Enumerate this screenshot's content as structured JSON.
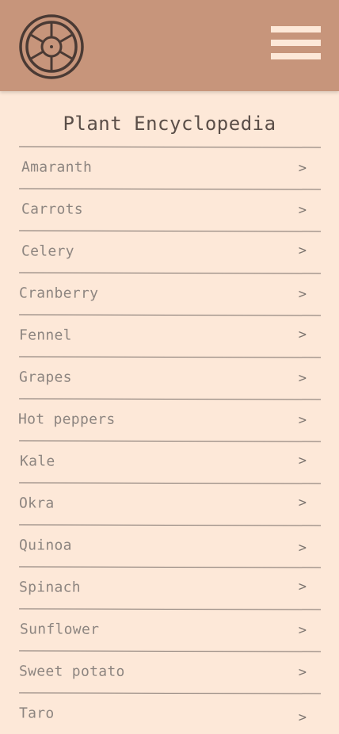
{
  "header": {
    "logo_icon": "ship-wheel-icon",
    "menu_icon": "hamburger-menu-icon"
  },
  "title": "Plant Encyclopedia",
  "plants": [
    {
      "label": "Amaranth",
      "chevron": ">"
    },
    {
      "label": "Carrots",
      "chevron": ">"
    },
    {
      "label": "Celery",
      "chevron": ">"
    },
    {
      "label": "Cranberry",
      "chevron": ">"
    },
    {
      "label": "Fennel",
      "chevron": ">"
    },
    {
      "label": "Grapes",
      "chevron": ">"
    },
    {
      "label": "Hot peppers",
      "chevron": ">"
    },
    {
      "label": "Kale",
      "chevron": ">"
    },
    {
      "label": "Okra",
      "chevron": ">"
    },
    {
      "label": "Quinoa",
      "chevron": ">"
    },
    {
      "label": "Spinach",
      "chevron": ">"
    },
    {
      "label": "Sunflower",
      "chevron": ">"
    },
    {
      "label": "Sweet potato",
      "chevron": ">"
    },
    {
      "label": "Taro",
      "chevron": ">"
    }
  ],
  "colors": {
    "header_bg": "#c7957b",
    "page_bg": "#fde8d8",
    "text": "#8d8580",
    "title": "#5a4e48"
  }
}
